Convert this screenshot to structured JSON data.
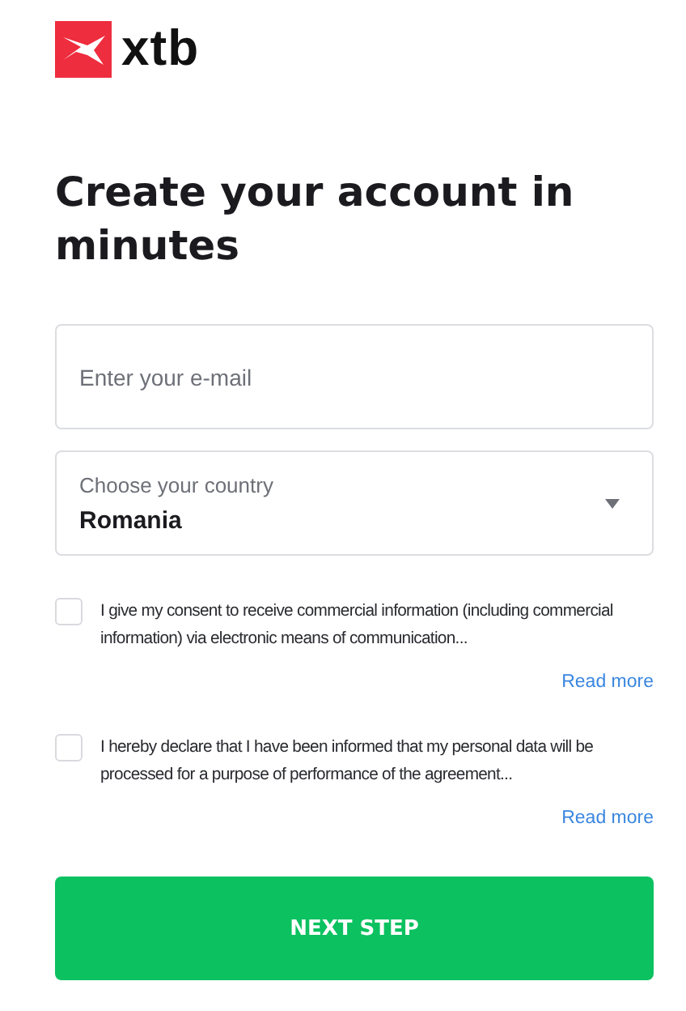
{
  "logo": {
    "text": "xtb"
  },
  "heading": "Create your account in minutes",
  "email_field": {
    "placeholder": "Enter your e-mail"
  },
  "country_field": {
    "label": "Choose your country",
    "value": "Romania"
  },
  "consents": [
    {
      "text": "I give my consent to receive commercial information (including commercial information) via electronic means of communication...",
      "checked": false,
      "link": "Read more"
    },
    {
      "text": "I hereby declare that I have been informed that my personal data will be processed for a purpose of performance of the agreement...",
      "checked": false,
      "link": "Read more"
    }
  ],
  "submit_button": "NEXT STEP"
}
